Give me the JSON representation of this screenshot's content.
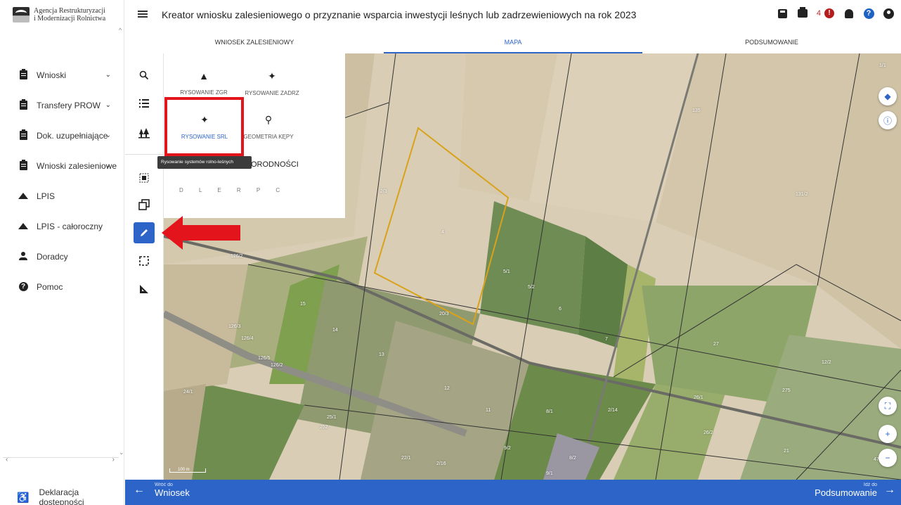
{
  "sidebar": {
    "logo_line1": "Agencja Restrukturyzacji",
    "logo_line2": "i Modernizacji Rolnictwa",
    "items": [
      {
        "label": "Wnioski",
        "icon": "clipboard-icon",
        "has_chevron": true
      },
      {
        "label": "Transfery PROW",
        "icon": "clipboard-icon",
        "has_chevron": true
      },
      {
        "label": "Dok. uzupełniające",
        "icon": "clipboard-icon",
        "has_chevron": true
      },
      {
        "label": "Wnioski zalesieniowe",
        "icon": "clipboard-icon",
        "has_chevron": true
      },
      {
        "label": "LPIS",
        "icon": "mountain-icon",
        "has_chevron": false
      },
      {
        "label": "LPIS - całoroczny",
        "icon": "mountain-icon",
        "has_chevron": false
      },
      {
        "label": "Doradcy",
        "icon": "person-icon",
        "has_chevron": false
      },
      {
        "label": "Pomoc",
        "icon": "help-icon",
        "has_chevron": false
      }
    ],
    "accessibility_label": "Deklaracja dostępności"
  },
  "header": {
    "title": "Kreator wniosku zalesieniowego o przyznanie wsparcia inwestycji leśnych lub zadrzewieniowych na rok 2023",
    "notification_count": "4"
  },
  "tabs": [
    {
      "label": "WNIOSEK ZALESIENIOWY",
      "active": false
    },
    {
      "label": "MAPA",
      "active": true
    },
    {
      "label": "PODSUMOWANIE",
      "active": false
    }
  ],
  "drawing_panel": {
    "items": [
      {
        "label": "RYSOWANIE ZGR",
        "icon": "tree-icon"
      },
      {
        "label": "RYSOWANIE ZADRZ",
        "icon": "sprout-icon"
      },
      {
        "label": "RYSOWANIE SRL",
        "icon": "sprout-icon",
        "selected": true
      },
      {
        "label": "GEOMETRIA KĘPY",
        "icon": "pin-icon"
      }
    ],
    "tooltip": "Rysowanie systemów rolno-leśnych",
    "partial_label": "ORODNOŚCI",
    "letters": "D L E R P C"
  },
  "map": {
    "parcel_labels": [
      "1/1",
      "135",
      "2/3",
      "4",
      "131/2",
      "126/2",
      "5/1",
      "5/2",
      "6",
      "15",
      "7",
      "20/3",
      "126/3",
      "14",
      "126/4",
      "27",
      "13",
      "126/5",
      "126/2",
      "12/2",
      "12",
      "24/1",
      "275",
      "26/1",
      "25/1",
      "11",
      "8/1",
      "252",
      "2/14",
      "9/2",
      "8/2",
      "26/2",
      "22/1",
      "2/16",
      "9/1",
      "21",
      "47/2"
    ],
    "scale_label": "100 m"
  },
  "bottombar": {
    "back_small": "Wróć do",
    "back_large": "Wniosek",
    "next_small": "Idź do",
    "next_large": "Podsumowanie"
  },
  "colors": {
    "accent": "#2c64c8",
    "highlight": "#e3141b",
    "arrow": "#e3141b"
  }
}
